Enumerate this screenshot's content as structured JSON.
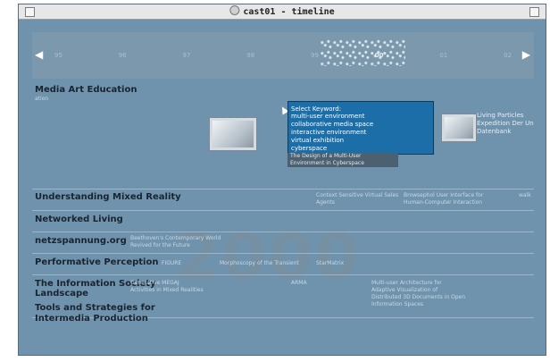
{
  "window": {
    "title": "cast01 - timeline"
  },
  "timeline": {
    "years": [
      "95",
      "96",
      "97",
      "98",
      "99",
      "00",
      "01",
      "02"
    ],
    "active_year": "00",
    "left_arrow": "◀",
    "right_arrow": "▶"
  },
  "big_year": "2000",
  "categories": [
    {
      "title": "Media Art Education",
      "subs": [
        "ation"
      ]
    },
    {
      "title": "Understanding Mixed Reality",
      "subs": [
        "Context Sensitive Virtual Sales",
        "Agents",
        "Browsephol User Interface for",
        "Human-Computer Interaction",
        "walk"
      ]
    },
    {
      "title": "Networked Living",
      "subs": []
    },
    {
      "title": "netzspannung.org",
      "subs": [
        "Beethoven's Contemporary World",
        "Revived for the Future"
      ]
    },
    {
      "title": "Performative Perception",
      "subs": [
        "FIGURE",
        "Morphoscopy of the Transient",
        "StarMatrix"
      ]
    },
    {
      "title": "The Information Society Landscape",
      "subs": [
        "Generative MEGAJ",
        "Activities in Mixed Realities",
        "ARMA",
        "Multi-user Architecture for",
        "Adaptive Visualization of",
        "Distributed 3D Documents in Open",
        "Information Spaces"
      ]
    },
    {
      "title": "Tools and Strategies for Intermedia Production",
      "subs": []
    }
  ],
  "keyword_popup": {
    "heading": "Select Keyword:",
    "items": [
      "multi-user environment",
      "collaborative media space",
      "interactive environment",
      "virtual exhibition",
      "cyberspace"
    ]
  },
  "caption": {
    "line1": "The Design of a Multi-User",
    "line2": "Environment in Cyberspace"
  },
  "side_label": {
    "line1": "Living Particles",
    "line2": "Expedition Der Un",
    "line3": "Datenbank"
  }
}
